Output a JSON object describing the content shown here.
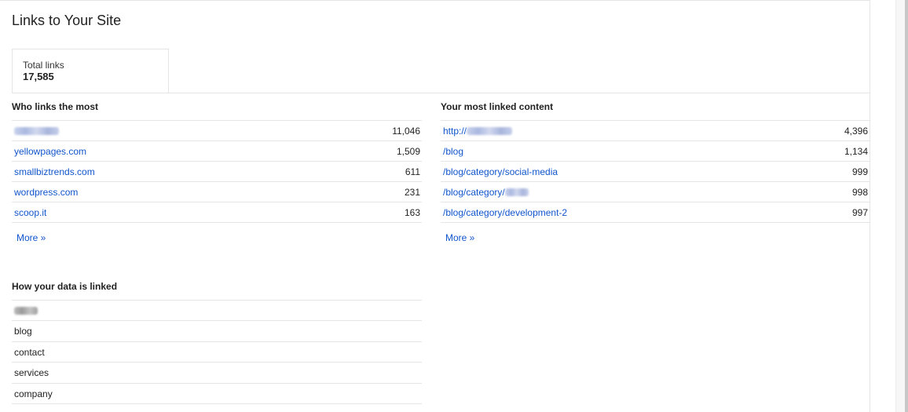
{
  "page": {
    "title": "Links to Your Site"
  },
  "summary": {
    "total_label": "Total links",
    "total_value": "17,585"
  },
  "who_links": {
    "heading": "Who links the most",
    "rows": [
      {
        "domain": "",
        "count": "11,046"
      },
      {
        "domain": "yellowpages.com",
        "count": "1,509"
      },
      {
        "domain": "smallbiztrends.com",
        "count": "611"
      },
      {
        "domain": "wordpress.com",
        "count": "231"
      },
      {
        "domain": "scoop.it",
        "count": "163"
      }
    ],
    "more": "More »"
  },
  "most_linked": {
    "heading": "Your most linked content",
    "rows": [
      {
        "path": "http://",
        "count": "4,396"
      },
      {
        "path": "/blog",
        "count": "1,134"
      },
      {
        "path": "/blog/category/social-media",
        "count": "999"
      },
      {
        "path": "/blog/category/",
        "count": "998"
      },
      {
        "path": "/blog/category/development-2",
        "count": "997"
      }
    ],
    "more": "More »"
  },
  "data_linked": {
    "heading": "How your data is linked",
    "rows": [
      {
        "text": ""
      },
      {
        "text": "blog"
      },
      {
        "text": "contact"
      },
      {
        "text": "services"
      },
      {
        "text": "company"
      }
    ]
  },
  "colors": {
    "link": "#1155cc",
    "border": "#e5e5e5",
    "text": "#222222"
  }
}
